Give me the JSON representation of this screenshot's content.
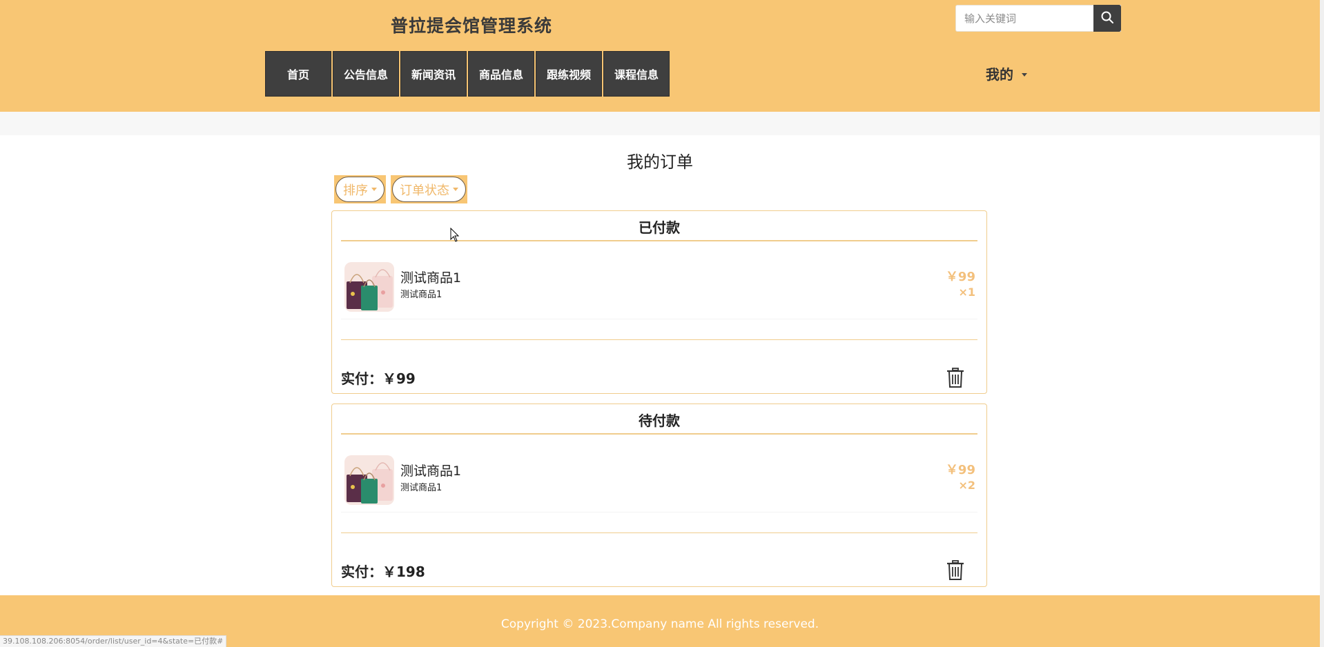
{
  "header": {
    "site_title": "普拉提会馆管理系统",
    "search_placeholder": "输入关键词",
    "my_menu_label": "我的"
  },
  "nav": {
    "items": [
      {
        "label": "首页"
      },
      {
        "label": "公告信息"
      },
      {
        "label": "新闻资讯"
      },
      {
        "label": "商品信息"
      },
      {
        "label": "跟练视频"
      },
      {
        "label": "课程信息"
      }
    ]
  },
  "main": {
    "page_title": "我的订单",
    "filters": {
      "sort_label": "排序",
      "status_label": "订单状态"
    },
    "orders": [
      {
        "status": "已付款",
        "product_name": "测试商品1",
        "product_sub": "测试商品1",
        "price": "￥99",
        "quantity": "×1",
        "paid_label": "实付：",
        "paid_amount": "￥99"
      },
      {
        "status": "待付款",
        "product_name": "测试商品1",
        "product_sub": "测试商品1",
        "price": "￥99",
        "quantity": "×2",
        "paid_label": "实付：",
        "paid_amount": "￥198"
      }
    ]
  },
  "footer": {
    "copyright": "Copyright © 2023.Company name All rights reserved."
  },
  "status_bar": {
    "url": "39.108.108.206:8054/order/list/user_id=4&state=已付款#"
  },
  "colors": {
    "brand": "#f8c674",
    "nav_bg": "#3f3f3f",
    "price": "#f3c07c"
  },
  "icons": {
    "search": "search-icon",
    "delete": "trash-icon"
  }
}
